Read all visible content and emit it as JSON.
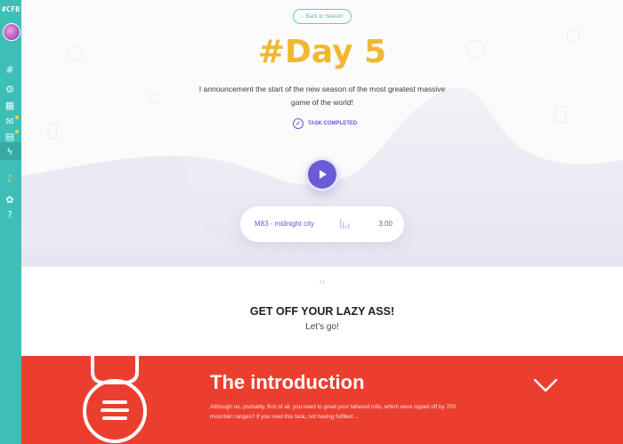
{
  "sidebar": {
    "logo": "#CFB",
    "icons": [
      "hashtag-icon",
      "settings-icon",
      "calendar-icon",
      "chat-icon",
      "bookmark-icon",
      "lightning-icon",
      "bell-icon",
      "gift-icon",
      "help-icon"
    ]
  },
  "header": {
    "back_label": "Back to Season",
    "title": "#Day 5",
    "description": "I announcement the start of the new season of the most greatest massive game of the world!",
    "task_status": "TASK COMPLETED"
  },
  "player": {
    "track": "M83 - midnight city",
    "duration": "3:00"
  },
  "quote": {
    "mark": "”",
    "heading": "GET OFF YOUR LAZY ASS!",
    "subheading": "Let’s go!"
  },
  "intro": {
    "title": "The introduction",
    "text": "Although no, probably, first of all, you need to greet your tattered rolls, which were ripped off by 700 mountain ranges? If you read this task, not having fulfilled ..."
  },
  "colors": {
    "sidebar": "#3dbfb8",
    "accent_purple": "#6a57d8",
    "title_yellow": "#f0b830",
    "intro_red": "#ec3e2f"
  }
}
